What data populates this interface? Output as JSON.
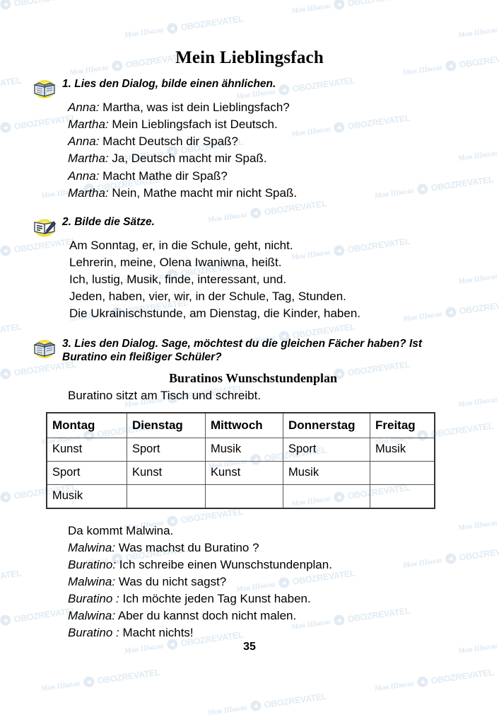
{
  "page": {
    "title": "Mein Lieblingsfach",
    "number": "35"
  },
  "watermark": {
    "school": "Моя Школа",
    "brand": "OBOZREVATEL",
    "icon": "play-circle-icon",
    "color": "#c9dbe9"
  },
  "exercises": [
    {
      "icon": "open-book-icon",
      "heading": "1. Lies den Dialog, bilde einen ähnlichen.",
      "lines": [
        {
          "speaker": "Anna:",
          "text": " Martha, was ist dein Lieblingsfach?"
        },
        {
          "speaker": "Martha:",
          "text": " Mein Lieblingsfach ist Deutsch."
        },
        {
          "speaker": "Anna:",
          "text": " Macht Deutsch dir Spaß?"
        },
        {
          "speaker": "Martha:",
          "text": " Ja, Deutsch macht mir Spaß."
        },
        {
          "speaker": "Anna:",
          "text": " Macht Mathe dir Spaß?"
        },
        {
          "speaker": "Martha:",
          "text": " Nein, Mathe macht mir nicht Spaß."
        }
      ]
    },
    {
      "icon": "book-pencil-icon",
      "heading": "2. Bilde die Sätze.",
      "lines": [
        {
          "speaker": "",
          "text": "Am Sonntag, er, in die Schule, geht, nicht."
        },
        {
          "speaker": "",
          "text": "Lehrerin, meine, Olena Iwaniwna, heißt."
        },
        {
          "speaker": "",
          "text": "Ich, lustig, Musik, finde, interessant, und."
        },
        {
          "speaker": "",
          "text": "Jeden, haben, vier, wir, in der Schule, Tag, Stunden."
        },
        {
          "speaker": "",
          "text": "Die Ukrainischstunde, am Dienstag, die Kinder, haben."
        }
      ]
    },
    {
      "icon": "open-book-icon",
      "heading": "3. Lies den Dialog. Sage, möchtest du die gleichen Fächer haben? Ist Buratino ein fleißiger Schüler?",
      "lines": []
    }
  ],
  "timetable": {
    "subtitle": "Buratinos Wunschstundenplan",
    "intro": "Buratino  sitzt am Tisch und schreibt.",
    "headers": [
      "Montag",
      "Dienstag",
      "Mittwoch",
      "Donnerstag",
      "Freitag"
    ],
    "rows": [
      [
        "Kunst",
        "Sport",
        "Musik",
        "Sport",
        "Musik"
      ],
      [
        "Sport",
        "Kunst",
        "Kunst",
        "Musik",
        ""
      ],
      [
        "Musik",
        "",
        "",
        "",
        ""
      ]
    ]
  },
  "closing": {
    "lines": [
      {
        "speaker": "",
        "text": "Da kommt Malwina."
      },
      {
        "speaker": "Malwina:",
        "text": " Was machst du Buratino ?"
      },
      {
        "speaker": "Buratino:",
        "text": " Ich schreibe einen Wunschstundenplan."
      },
      {
        "speaker": "Malwina:",
        "text": " Was du nicht sagst?"
      },
      {
        "speaker": "Buratino :",
        "text": " Ich möchte jeden Tag Kunst haben."
      },
      {
        "speaker": "Malwina:",
        "text": " Aber du kannst doch nicht malen."
      },
      {
        "speaker": "Buratino :",
        "text": " Macht nichts!"
      }
    ]
  }
}
